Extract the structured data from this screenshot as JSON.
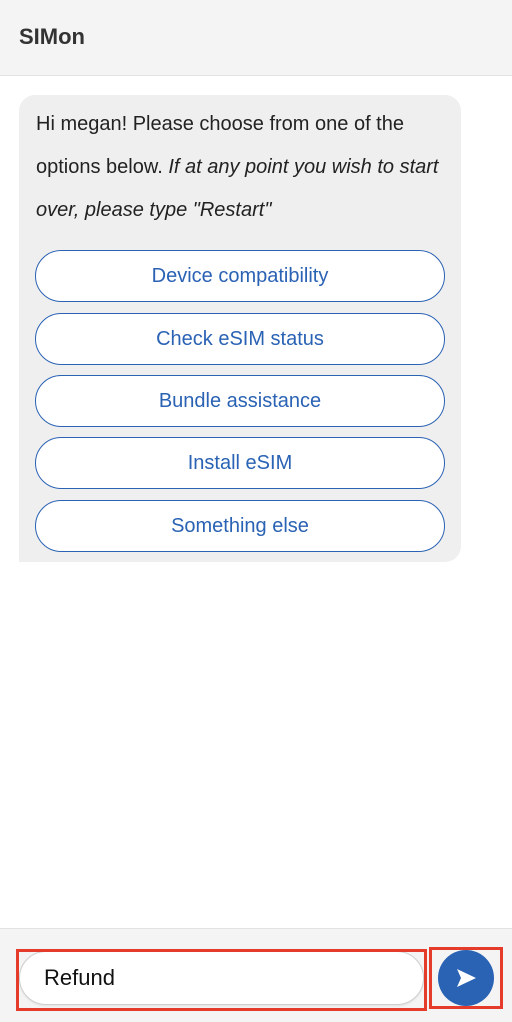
{
  "header": {
    "title": "SIMon"
  },
  "message": {
    "greeting": "Hi megan! Please choose from one of the options below. ",
    "note": "If at any point you wish to start over, please type \"Restart\""
  },
  "options": [
    {
      "label": "Device compatibility"
    },
    {
      "label": "Check eSIM status"
    },
    {
      "label": "Bundle assistance"
    },
    {
      "label": "Install eSIM"
    },
    {
      "label": "Something else"
    }
  ],
  "composer": {
    "value": "Refund",
    "send_icon": "send-arrow-icon"
  },
  "colors": {
    "accent": "#2a62b4",
    "highlight": "#e53b2b"
  }
}
